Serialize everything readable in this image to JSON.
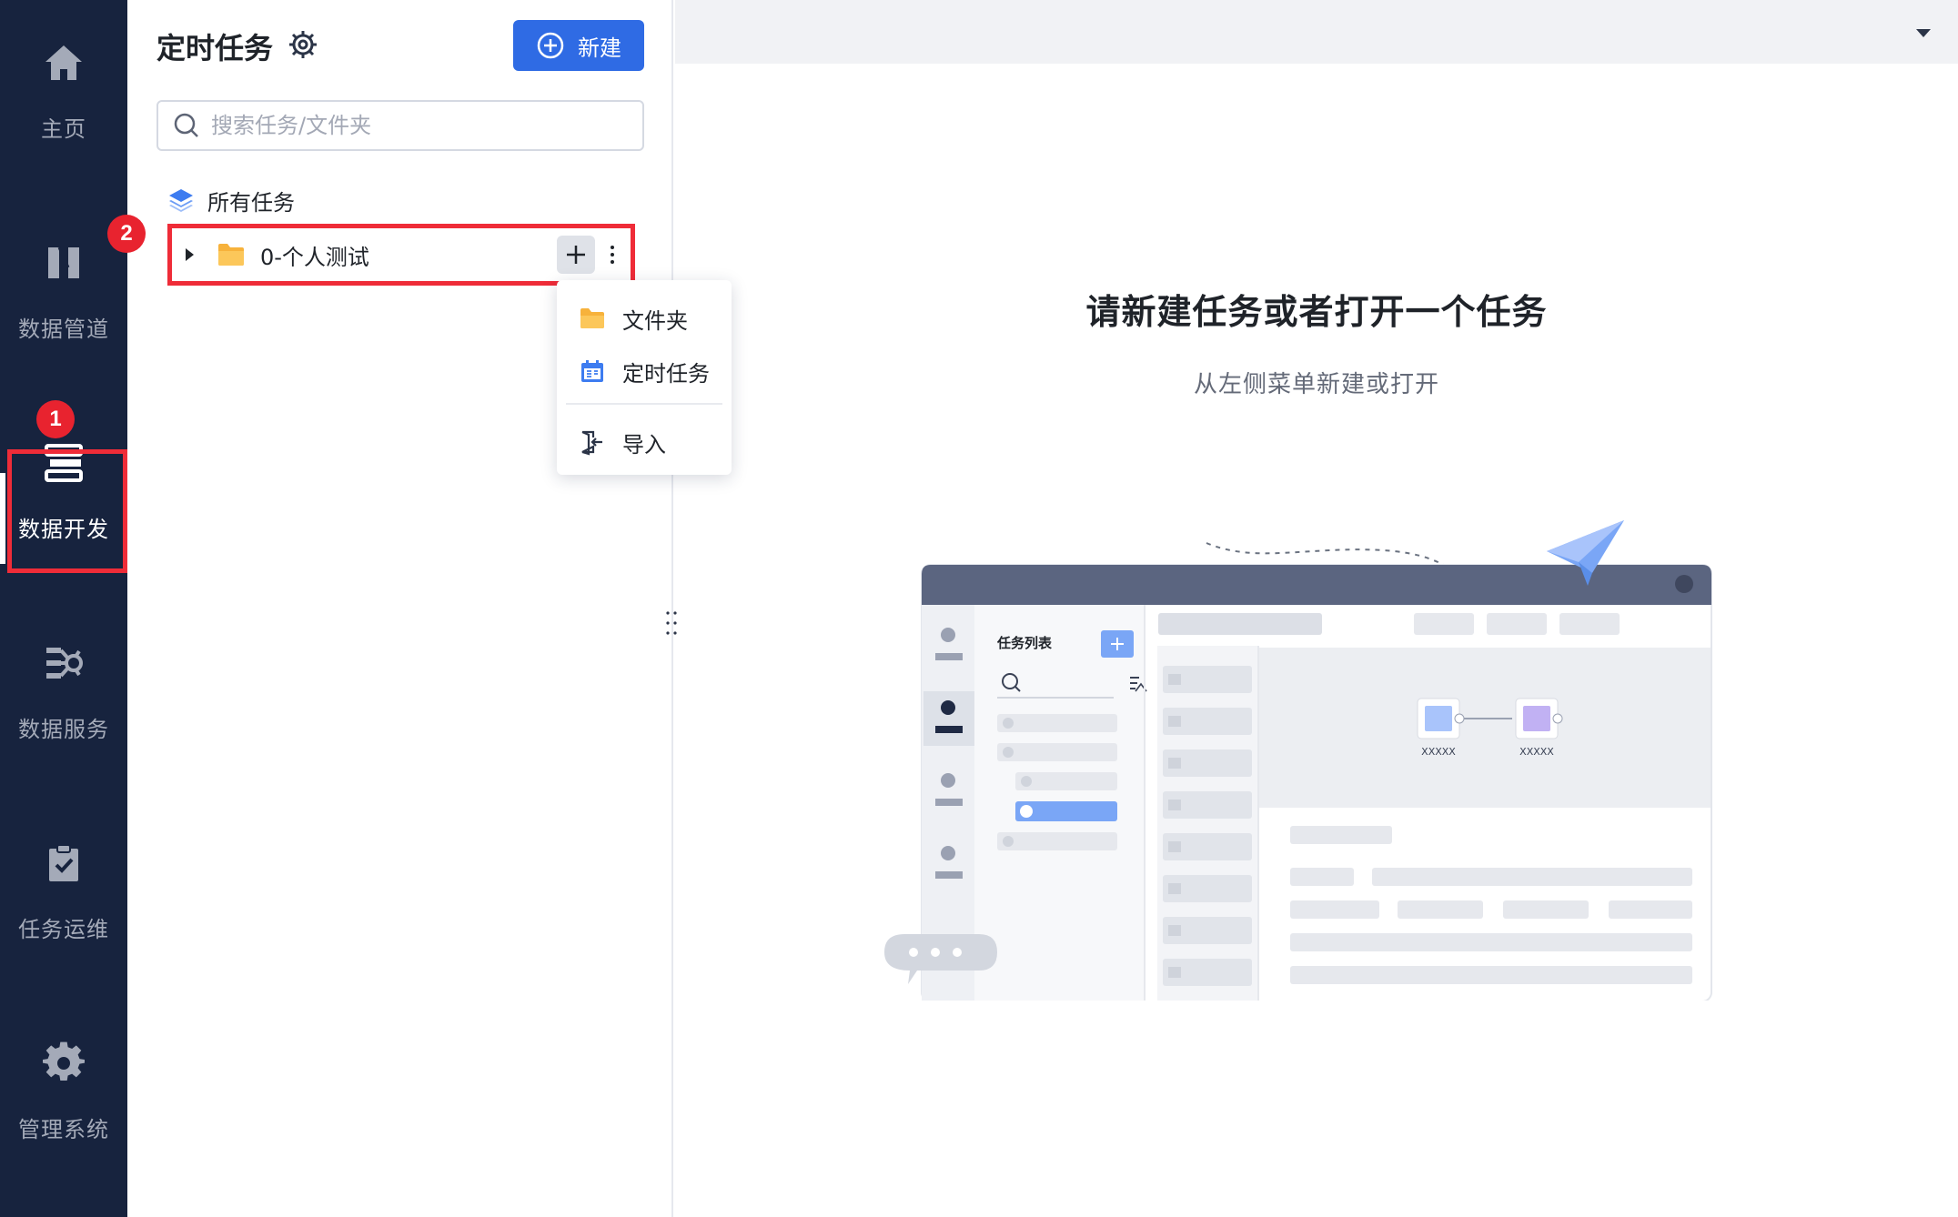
{
  "nav": {
    "items": [
      {
        "label": "主页",
        "icon": "home-icon"
      },
      {
        "label": "数据管道",
        "icon": "pipeline-icon"
      },
      {
        "label": "数据开发",
        "icon": "dev-icon",
        "active": true
      },
      {
        "label": "数据服务",
        "icon": "service-icon"
      },
      {
        "label": "任务运维",
        "icon": "task-ops-icon"
      },
      {
        "label": "管理系统",
        "icon": "gear-icon"
      }
    ]
  },
  "annotations": {
    "step1": "1",
    "step2": "2"
  },
  "panel": {
    "title": "定时任务",
    "new_button": "新建",
    "search_placeholder": "搜索任务/文件夹",
    "all_tasks": "所有任务",
    "folder_name": "0-个人测试"
  },
  "menu": {
    "items": [
      {
        "label": "文件夹",
        "icon": "folder-icon"
      },
      {
        "label": "定时任务",
        "icon": "calendar-icon"
      },
      {
        "label": "导入",
        "icon": "import-icon"
      }
    ]
  },
  "main": {
    "title": "请新建任务或者打开一个任务",
    "subtitle": "从左侧菜单新建或打开"
  },
  "illustration": {
    "list_title": "任务列表",
    "node1": "XXXXX",
    "node2": "XXXXX"
  },
  "colors": {
    "nav_bg": "#17233e",
    "accent": "#2f6be4",
    "highlight": "#ef2c38"
  }
}
